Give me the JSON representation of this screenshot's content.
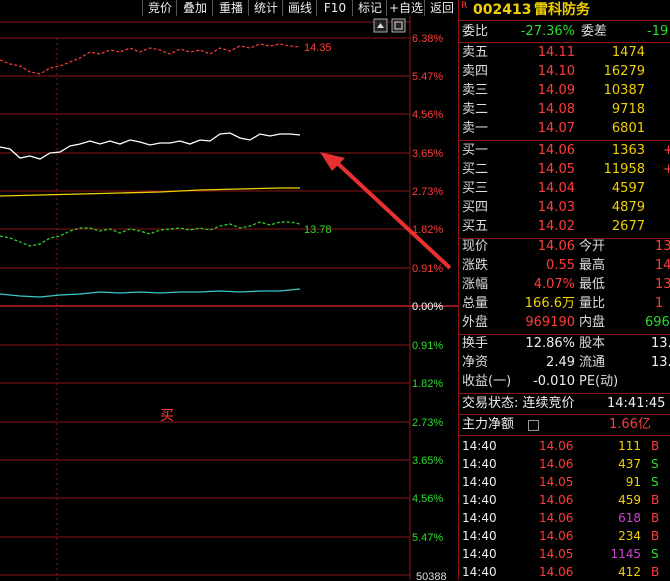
{
  "toolbar": {
    "buttons": [
      "竞价",
      "叠加",
      "重播",
      "统计",
      "画线",
      "F10",
      "标记",
      "+自选",
      "返回"
    ],
    "settings_icon": "settings-icon",
    "scroll_icon": "scroll-up-icon"
  },
  "chart": {
    "pct_labels": [
      "6.38%",
      "5.47%",
      "4.56%",
      "3.65%",
      "2.73%",
      "1.82%",
      "0.91%",
      "0.00%",
      "0.91%",
      "1.82%",
      "2.73%",
      "3.65%",
      "4.56%",
      "5.47%"
    ],
    "bottom_label": "50388",
    "series_labels": {
      "red_dashed": "14.35",
      "green_dashed": "13.78"
    },
    "buy_marker": "买",
    "colors": {
      "grid": "#8a1515",
      "up": "#ff3c3c",
      "down": "#2cdc2c",
      "price": "#ffffff",
      "avg": "#f0d000",
      "cyan": "#3cc8c8"
    }
  },
  "header": {
    "badge": "R",
    "code": "002413",
    "name": "雷科防务"
  },
  "weibi": {
    "label1": "委比",
    "value1": "-27.36%",
    "label2": "委差",
    "value2": "-19"
  },
  "asks": [
    {
      "label": "卖五",
      "price": "14.11",
      "vol": "1474"
    },
    {
      "label": "卖四",
      "price": "14.10",
      "vol": "16279"
    },
    {
      "label": "卖三",
      "price": "14.09",
      "vol": "10387"
    },
    {
      "label": "卖二",
      "price": "14.08",
      "vol": "9718"
    },
    {
      "label": "卖一",
      "price": "14.07",
      "vol": "6801"
    }
  ],
  "bids": [
    {
      "label": "买一",
      "price": "14.06",
      "vol": "1363",
      "flag": "+"
    },
    {
      "label": "买二",
      "price": "14.05",
      "vol": "11958",
      "flag": "+"
    },
    {
      "label": "买三",
      "price": "14.04",
      "vol": "4597",
      "flag": ""
    },
    {
      "label": "买四",
      "price": "14.03",
      "vol": "4879",
      "flag": ""
    },
    {
      "label": "买五",
      "price": "14.02",
      "vol": "2677",
      "flag": ""
    }
  ],
  "quote": [
    {
      "l1": "现价",
      "v1": "14.06",
      "c1": "red",
      "l2": "今开",
      "v2": "13"
    },
    {
      "l1": "涨跌",
      "v1": "0.55",
      "c1": "red",
      "l2": "最高",
      "v2": "14"
    },
    {
      "l1": "涨幅",
      "v1": "4.07%",
      "c1": "red",
      "l2": "最低",
      "v2": "13"
    },
    {
      "l1": "总量",
      "v1": "166.6万",
      "c1": "yellow",
      "l2": "量比",
      "v2": "1"
    },
    {
      "l1": "外盘",
      "v1": "969190",
      "c1": "red",
      "l2": "内盘",
      "v2": "696"
    }
  ],
  "fundamental": [
    {
      "l1": "换手",
      "v1": "12.86%",
      "l2": "股本",
      "v2": "13."
    },
    {
      "l1": "净资",
      "v1": "2.49",
      "l2": "流通",
      "v2": "13."
    },
    {
      "l1": "收益(一)",
      "v1": "-0.010",
      "l2": "PE(动)",
      "v2": ""
    }
  ],
  "status": {
    "label": "交易状态: 连续竞价",
    "time": "14:41:45"
  },
  "main_force": {
    "label": "主力净额",
    "value": "1.66亿"
  },
  "ticks": [
    {
      "time": "14:40",
      "price": "14.06",
      "vol": "111",
      "side": "B",
      "volc": "yellow"
    },
    {
      "time": "14:40",
      "price": "14.06",
      "vol": "437",
      "side": "S",
      "volc": "yellow"
    },
    {
      "time": "14:40",
      "price": "14.05",
      "vol": "91",
      "side": "S",
      "volc": "yellow"
    },
    {
      "time": "14:40",
      "price": "14.06",
      "vol": "459",
      "side": "B",
      "volc": "yellow"
    },
    {
      "time": "14:40",
      "price": "14.06",
      "vol": "618",
      "side": "B",
      "volc": "mag"
    },
    {
      "time": "14:40",
      "price": "14.06",
      "vol": "234",
      "side": "B",
      "volc": "yellow"
    },
    {
      "time": "14:40",
      "price": "14.05",
      "vol": "1145",
      "side": "S",
      "volc": "mag"
    },
    {
      "time": "14:40",
      "price": "14.06",
      "vol": "412",
      "side": "B",
      "volc": "yellow"
    }
  ]
}
